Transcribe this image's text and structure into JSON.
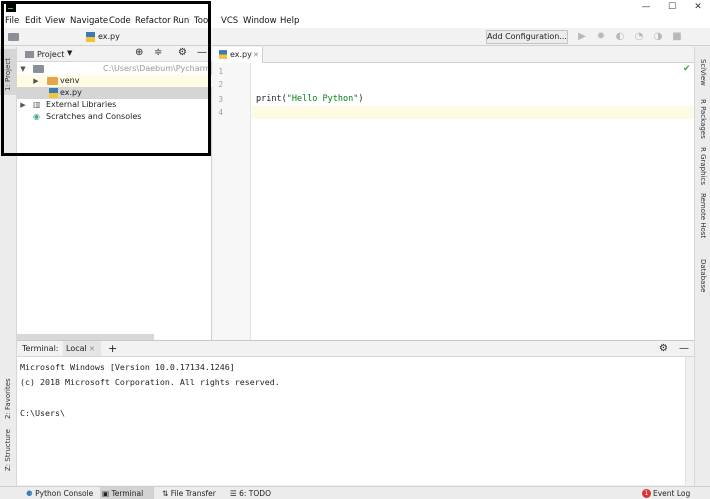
{
  "menu": [
    "File",
    "Edit",
    "View",
    "Navigate",
    "Code",
    "Refactor",
    "Run",
    "Tools",
    "VCS",
    "Window",
    "Help"
  ],
  "navbar": {
    "file_crumb": "ex.py",
    "add_config": "Add Configuration..."
  },
  "left_strip": {
    "project": "1: Project",
    "favorites": "2: Favorites",
    "structure": "Z: Structure"
  },
  "right_strip": {
    "sciview": "SciView",
    "r_packages": "R Packages",
    "r_graphics": "R Graphics",
    "remote_host": "Remote Host",
    "database": "Database"
  },
  "project": {
    "title": "Project",
    "root_path": "C:\\Users\\Daebum\\Pycharm",
    "items": [
      "venv",
      "ex.py",
      "External Libraries",
      "Scratches and Consoles"
    ]
  },
  "editor": {
    "tab": "ex.py",
    "line_numbers": [
      "1",
      "2",
      "3",
      "4"
    ],
    "code_fn": "print(",
    "code_str": "\"Hello Python\"",
    "code_end": ")"
  },
  "terminal": {
    "title": "Terminal:",
    "tab": "Local",
    "lines": [
      "Microsoft Windows [Version 10.0.17134.1246]",
      "(c) 2018 Microsoft Corporation. All rights reserved.",
      "",
      "C:\\Users\\"
    ]
  },
  "bottom": {
    "python_console": "Python Console",
    "terminal": "Terminal",
    "file_transfer": "File Transfer",
    "todo": "6: TODO",
    "event_log": "Event Log",
    "event_count": "1"
  },
  "colors": {
    "editor_bg": "#ffffff",
    "current_line": "#fffae3",
    "string": "#067d17",
    "selected_row": "#d5d5d5"
  }
}
